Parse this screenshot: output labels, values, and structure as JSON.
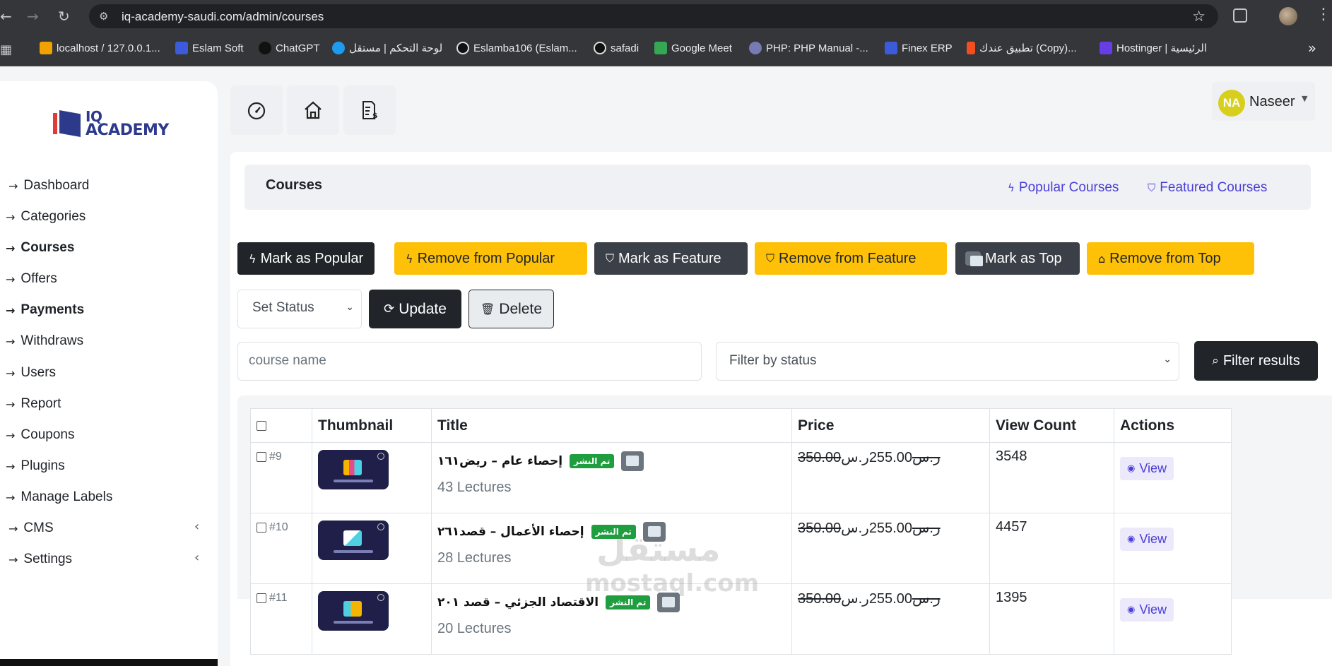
{
  "browser": {
    "url": "iq-academy-saudi.com/admin/courses",
    "bookmarks": [
      {
        "label": "localhost / 127.0.0.1...",
        "color": "#f2a200"
      },
      {
        "label": "Eslam Soft",
        "color": "#3b5bdb"
      },
      {
        "label": "ChatGPT",
        "color": "#111111"
      },
      {
        "label": "لوحة التحكم | مستقل",
        "color": "#1d9bf0"
      },
      {
        "label": "Eslamba106 (Eslam...",
        "color": "#111111"
      },
      {
        "label": "safadi",
        "color": "#111111"
      },
      {
        "label": "Google Meet",
        "color": "#34a853"
      },
      {
        "label": "PHP: PHP Manual -...",
        "color": "#777bb3"
      },
      {
        "label": "Finex ERP",
        "color": "#3b5bdb"
      },
      {
        "label": "تطبيق عندك (Copy)...",
        "color": "#f24e1e"
      },
      {
        "label": "Hostinger | الرئيسية",
        "color": "#673de6"
      }
    ]
  },
  "sidebar": {
    "logo": {
      "line1": "IQ",
      "line2": "ACADEMY"
    },
    "items": [
      {
        "label": "Dashboard",
        "bold": false
      },
      {
        "label": "Categories",
        "bold": false
      },
      {
        "label": "Courses",
        "bold": true
      },
      {
        "label": "Offers",
        "bold": false
      },
      {
        "label": "Payments",
        "bold": true
      },
      {
        "label": "Withdraws",
        "bold": false
      },
      {
        "label": "Users",
        "bold": false
      },
      {
        "label": "Report",
        "bold": false
      },
      {
        "label": "Coupons",
        "bold": false
      },
      {
        "label": "Plugins",
        "bold": false
      },
      {
        "label": "Manage Labels",
        "bold": false
      },
      {
        "label": "CMS",
        "bold": false
      },
      {
        "label": "Settings",
        "bold": false
      }
    ]
  },
  "user": {
    "initials": "NA",
    "name": "Naseer"
  },
  "card": {
    "title": "Courses",
    "popular_link": "Popular Courses",
    "featured_link": "Featured Courses"
  },
  "actions": {
    "mark_popular": "Mark as Popular",
    "remove_popular": "Remove from Popular",
    "mark_feature": "Mark as Feature",
    "remove_feature": "Remove from Feature",
    "mark_top": "Mark as Top",
    "remove_top": "Remove from Top",
    "set_status": "Set Status",
    "update": "Update",
    "delete": "Delete"
  },
  "filters": {
    "course_placeholder": "course name",
    "status_placeholder": "Filter by status",
    "filter_button": "Filter results"
  },
  "table": {
    "headers": {
      "thumbnail": "Thumbnail",
      "title": "Title",
      "price": "Price",
      "views": "View Count",
      "actions": "Actions"
    },
    "rows": [
      {
        "id": "#9",
        "title": "إحصاء عام – ريض١٦١",
        "badge": "تم النشر",
        "lectures": "43 Lectures",
        "old_price": "350.00ر.س",
        "price": "255.00ر.س",
        "views": "3548",
        "action": "View"
      },
      {
        "id": "#10",
        "title": "إحصاء الأعمال – قصد٢٦١",
        "badge": "تم النشر",
        "lectures": "28 Lectures",
        "old_price": "350.00ر.س",
        "price": "255.00ر.س",
        "views": "4457",
        "action": "View"
      },
      {
        "id": "#11",
        "title": "الاقتصاد الجزئي – قصد ٢٠١",
        "badge": "تم النشر",
        "lectures": "20 Lectures",
        "old_price": "350.00ر.س",
        "price": "255.00ر.س",
        "views": "1395",
        "action": "View"
      }
    ]
  },
  "watermark": {
    "ar": "مستقل",
    "en": "mostaql.com"
  }
}
